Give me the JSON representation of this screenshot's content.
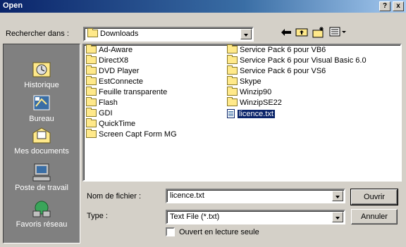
{
  "window": {
    "title": "Open",
    "help_label": "?",
    "close_label": "x"
  },
  "lookin": {
    "label": "Rechercher dans :",
    "value": "Downloads"
  },
  "toolbar": {
    "back_icon": "back-arrow-icon",
    "up_icon": "up-folder-icon",
    "new_folder_icon": "new-folder-icon",
    "view_icon": "view-menu-icon"
  },
  "places": [
    {
      "label": "Historique",
      "icon": "history-icon"
    },
    {
      "label": "Bureau",
      "icon": "desktop-icon"
    },
    {
      "label": "Mes documents",
      "icon": "my-documents-icon"
    },
    {
      "label": "Poste de travail",
      "icon": "my-computer-icon"
    },
    {
      "label": "Favoris réseau",
      "icon": "network-icon"
    }
  ],
  "files": [
    {
      "name": "Ad-Aware",
      "type": "folder"
    },
    {
      "name": "DirectX8",
      "type": "folder"
    },
    {
      "name": "DVD Player",
      "type": "folder"
    },
    {
      "name": "EstConnecte",
      "type": "folder"
    },
    {
      "name": "Feuille transparente",
      "type": "folder"
    },
    {
      "name": "Flash",
      "type": "folder"
    },
    {
      "name": "GDI",
      "type": "folder"
    },
    {
      "name": "QuickTime",
      "type": "folder"
    },
    {
      "name": "Screen Capt Form MG",
      "type": "folder"
    },
    {
      "name": "Service Pack 6 pour VB6",
      "type": "folder"
    },
    {
      "name": "Service Pack 6 pour Visual Basic 6.0",
      "type": "folder"
    },
    {
      "name": "Service Pack 6 pour VS6",
      "type": "folder"
    },
    {
      "name": "Skype",
      "type": "folder"
    },
    {
      "name": "Winzip90",
      "type": "folder"
    },
    {
      "name": "WinzipSE22",
      "type": "folder"
    },
    {
      "name": "licence.txt",
      "type": "file",
      "selected": true
    }
  ],
  "filename": {
    "label": "Nom de fichier :",
    "value": "licence.txt"
  },
  "filetype": {
    "label": "Type :",
    "value": "Text File (*.txt)"
  },
  "readonly": {
    "label": "Ouvert en lecture seule",
    "checked": false
  },
  "buttons": {
    "open": "Ouvrir",
    "cancel": "Annuler"
  },
  "colors": {
    "titlebar": "#0a246a",
    "face": "#d4d0c8",
    "places_bg": "#808080",
    "selection": "#0a246a"
  }
}
